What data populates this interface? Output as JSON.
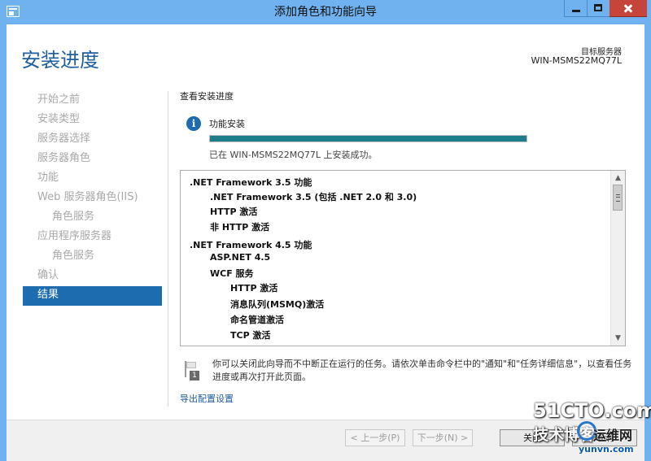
{
  "window": {
    "title": "添加角色和功能向导",
    "controls": {
      "minimize": "minimize",
      "maximize": "maximize",
      "close": "close"
    }
  },
  "header": {
    "page_title": "安装进度",
    "destination_label": "目标服务器",
    "destination_server": "WIN-MSMS22MQ77L"
  },
  "sidebar": {
    "items": [
      {
        "label": "开始之前",
        "state": "disabled"
      },
      {
        "label": "安装类型",
        "state": "disabled"
      },
      {
        "label": "服务器选择",
        "state": "disabled"
      },
      {
        "label": "服务器角色",
        "state": "disabled"
      },
      {
        "label": "功能",
        "state": "disabled"
      },
      {
        "label": "Web 服务器角色(IIS)",
        "state": "disabled"
      },
      {
        "label": "角色服务",
        "state": "disabled",
        "sub": true
      },
      {
        "label": "应用程序服务器",
        "state": "disabled"
      },
      {
        "label": "角色服务",
        "state": "disabled",
        "sub": true
      },
      {
        "label": "确认",
        "state": "disabled"
      },
      {
        "label": "结果",
        "state": "active"
      }
    ]
  },
  "content": {
    "section_title": "查看安装进度",
    "progress": {
      "label": "功能安装",
      "percent": 100,
      "status": "已在 WIN-MSMS22MQ77L 上安装成功。",
      "fill_color": "#1e7d8a"
    },
    "features": [
      {
        "text": ".NET Framework 3.5 功能",
        "level": 0
      },
      {
        "text": ".NET Framework 3.5 (包括 .NET 2.0 和 3.0)",
        "level": 1
      },
      {
        "text": "HTTP 激活",
        "level": 1
      },
      {
        "text": "非 HTTP 激活",
        "level": 1
      },
      {
        "text": ".NET Framework 4.5 功能",
        "level": 0
      },
      {
        "text": "ASP.NET 4.5",
        "level": 1
      },
      {
        "text": "WCF 服务",
        "level": 1
      },
      {
        "text": "HTTP 激活",
        "level": 2
      },
      {
        "text": "消息队列(MSMQ)激活",
        "level": 2
      },
      {
        "text": "命名管道激活",
        "level": 2
      },
      {
        "text": "TCP 激活",
        "level": 2
      }
    ],
    "notice": "你可以关闭此向导而不中断正在运行的任务。请依次单击命令栏中的\"通知\"和\"任务详细信息\"，以查看任务进度或再次打开此页面。",
    "notice_badge": "1",
    "export_link": "导出配置设置"
  },
  "footer": {
    "prev_button": "< 上一步(P)",
    "next_button": "下一步(N) >",
    "close_button": "关闭",
    "cancel_button": "取消"
  },
  "watermark": {
    "line1": "51CTO.com",
    "line2": "技术博客",
    "line3": "运维网",
    "line4": "yunvn.com"
  },
  "colors": {
    "title_bar": "#6fb2ef",
    "accent": "#1e6cb0",
    "close": "#c7443a"
  }
}
